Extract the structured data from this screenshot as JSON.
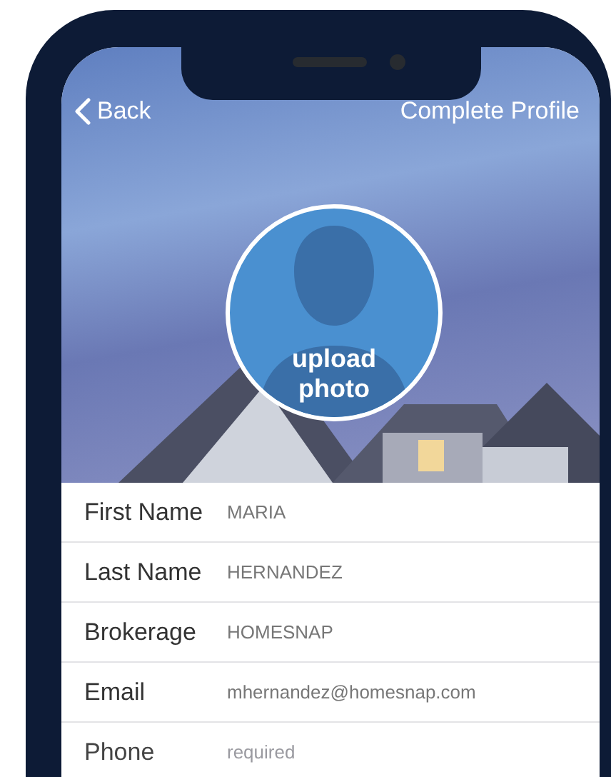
{
  "nav": {
    "back": "Back",
    "title": "Complete Profile"
  },
  "avatar": {
    "label": "upload photo"
  },
  "fields": [
    {
      "label": "First Name",
      "value": "MARIA"
    },
    {
      "label": "Last Name",
      "value": "HERNANDEZ"
    },
    {
      "label": "Brokerage",
      "value": "HOMESNAP"
    },
    {
      "label": "Email",
      "value": "mhernandez@homesnap.com"
    },
    {
      "label": "Phone",
      "placeholder": "required"
    }
  ]
}
